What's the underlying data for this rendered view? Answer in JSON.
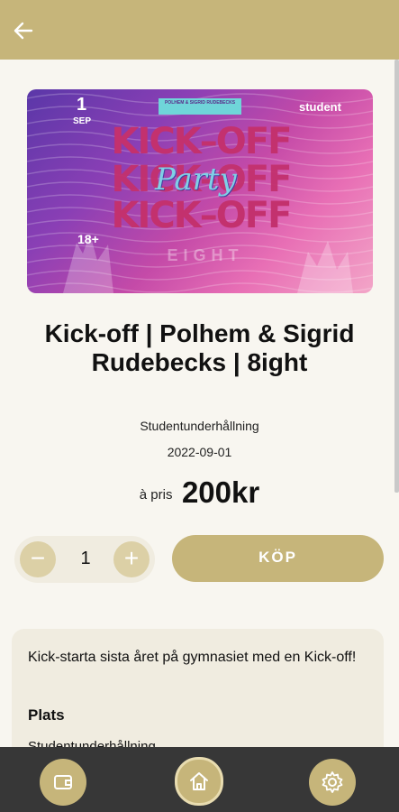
{
  "header": {
    "back_icon": "arrow-left-icon"
  },
  "banner": {
    "day": "1",
    "month": "SEP",
    "tag": "POLHEM & SIGRID RUDEBECKS",
    "brand": "student",
    "lines": [
      "KICK–OFF",
      "KICK–OFF",
      "KICK–OFF"
    ],
    "party": "Party",
    "age": "18+",
    "subline": "EIGHT"
  },
  "event": {
    "title": "Kick-off | Polhem & Sigrid Rudebecks | 8ight",
    "category": "Studentunderhållning",
    "date": "2022-09-01",
    "price_label": "à pris",
    "price": "200kr"
  },
  "purchase": {
    "minus": "−",
    "quantity": "1",
    "plus": "+",
    "buy_label": "KÖP"
  },
  "description": {
    "text": "Kick-starta sista året på gymnasiet med en Kick-off!",
    "location_heading": "Plats",
    "location_peek": "Studentunderhållning"
  },
  "nav": {
    "wallet_icon": "wallet-icon",
    "home_icon": "home-icon",
    "settings_icon": "gear-icon"
  },
  "colors": {
    "accent": "#c6b57a",
    "background": "#f8f6f0",
    "card": "#f0ece0",
    "nav": "#373737"
  }
}
